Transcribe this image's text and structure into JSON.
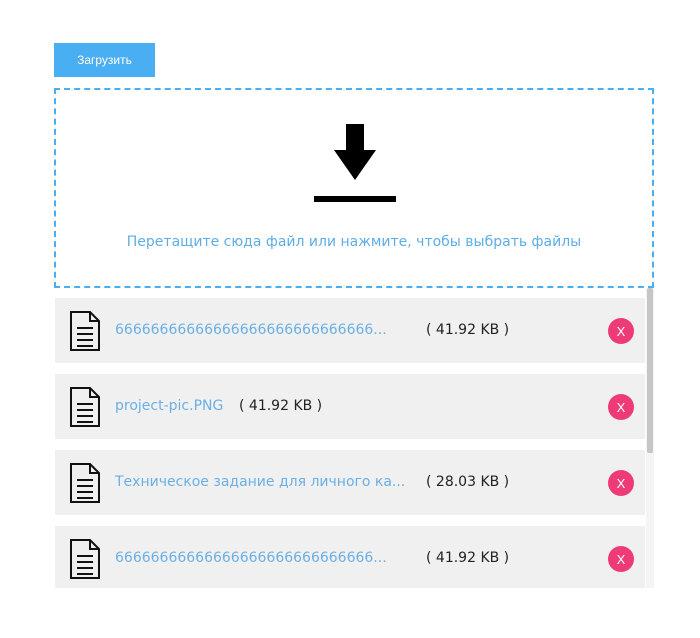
{
  "toolbar": {
    "upload_label": "Загрузить"
  },
  "dropzone": {
    "icon": "download-icon",
    "hint": "Перетащите сюда файл или нажмите, чтобы выбрать файлы"
  },
  "files": [
    {
      "name": "66666666666666666666666666666...",
      "size": "( 41.92 KB )"
    },
    {
      "name": "project-pic.PNG",
      "size": "( 41.92 KB )"
    },
    {
      "name": "Техническое задание для личного ка...",
      "size": "( 28.03 KB )"
    },
    {
      "name": "66666666666666666666666666666...",
      "size": "( 41.92 KB )"
    }
  ],
  "remove_label": "X",
  "colors": {
    "accent": "#4aaef2",
    "link": "#6ab0e6",
    "remove": "#ef3a78",
    "row_bg": "#f0f0f0"
  }
}
